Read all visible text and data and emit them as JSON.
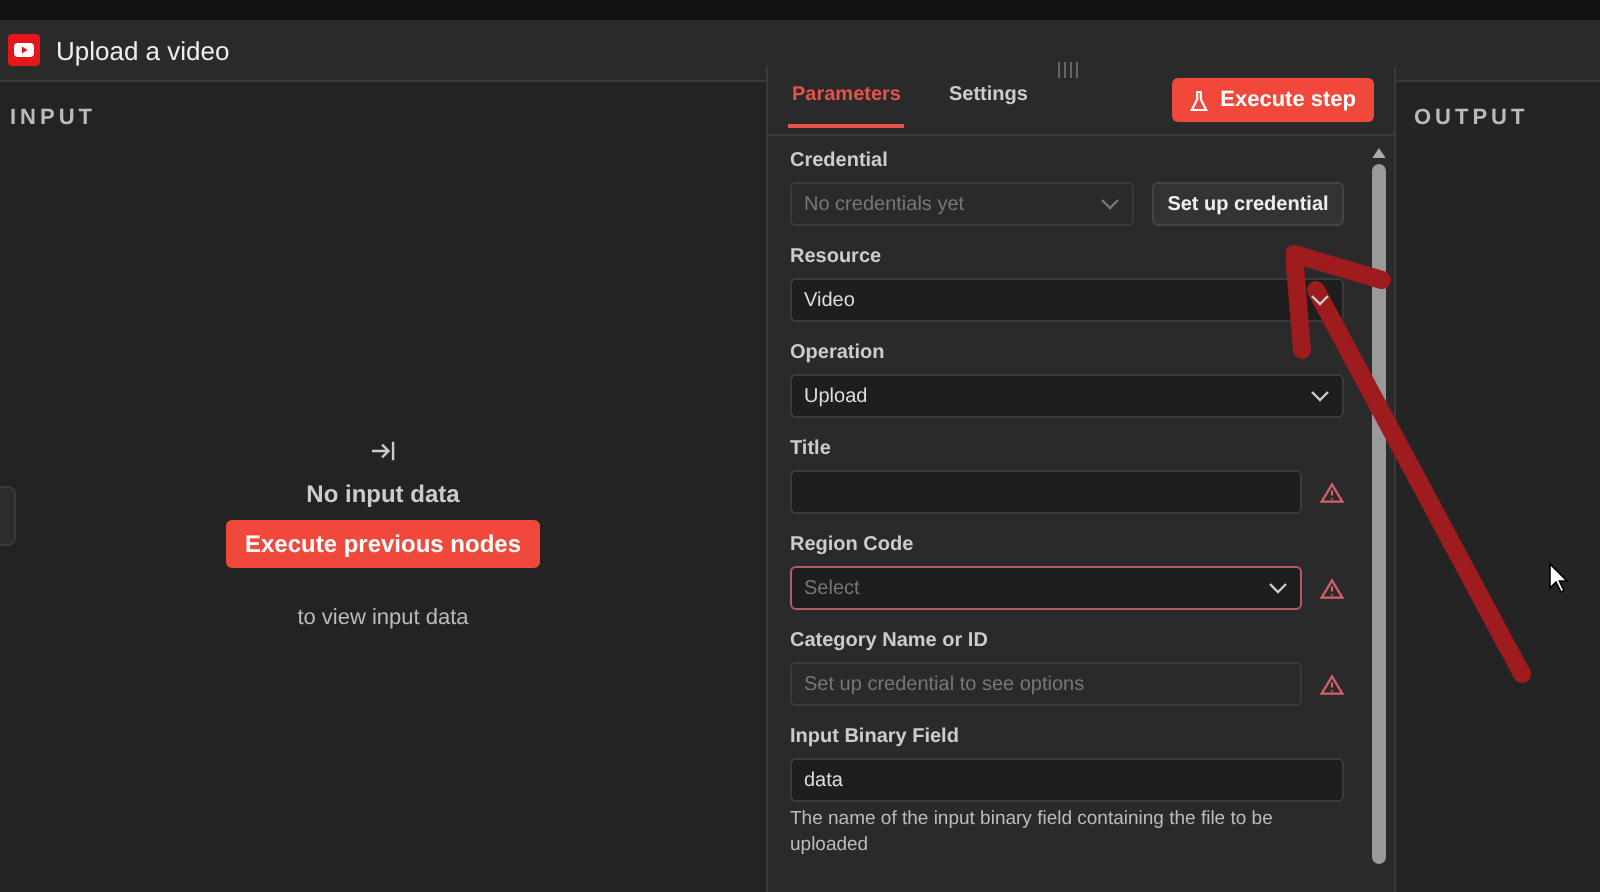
{
  "header": {
    "title": "Upload a video"
  },
  "input_panel": {
    "heading": "INPUT",
    "empty_title": "No input data",
    "button": "Execute previous nodes",
    "hint": "to view input data"
  },
  "params_panel": {
    "tabs": [
      {
        "label": "Parameters",
        "selected": true
      },
      {
        "label": "Settings",
        "selected": false
      }
    ],
    "execute_button": "Execute step",
    "fields": [
      {
        "kind": "credential",
        "label": "Credential",
        "placeholder": "No credentials yet",
        "button": "Set up credential"
      },
      {
        "kind": "select",
        "label": "Resource",
        "value": "Video",
        "warning": false,
        "invalid": false
      },
      {
        "kind": "select",
        "label": "Operation",
        "value": "Upload",
        "warning": false,
        "invalid": false
      },
      {
        "kind": "input",
        "label": "Title",
        "warning": true,
        "disabled": false
      },
      {
        "kind": "select",
        "label": "Region Code",
        "placeholder": "Select",
        "warning": true,
        "invalid": true
      },
      {
        "kind": "input",
        "label": "Category Name or ID",
        "placeholder": "Set up credential to see options",
        "warning": true,
        "disabled": true
      },
      {
        "kind": "input",
        "label": "Input Binary Field",
        "value": "data",
        "warning": false,
        "disabled": false,
        "hint": "The name of the input binary field containing the file to be uploaded"
      }
    ]
  },
  "output_panel": {
    "heading": "OUTPUT"
  }
}
